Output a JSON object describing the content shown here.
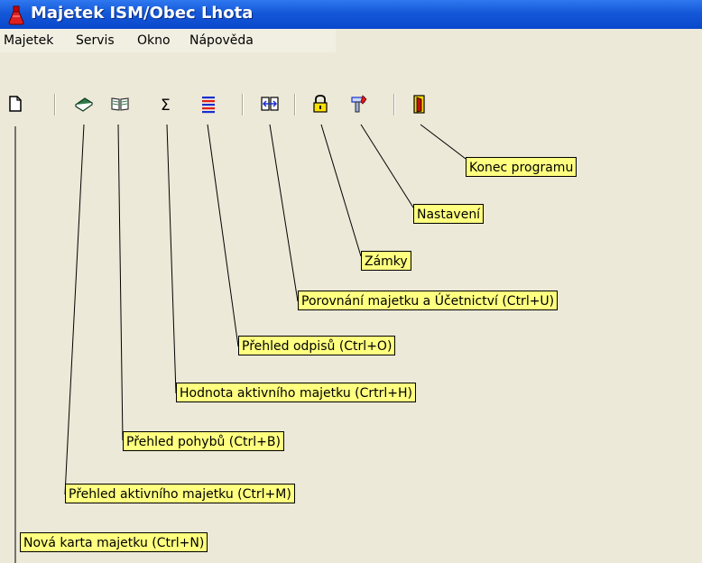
{
  "window": {
    "title": "Majetek ISM/Obec Lhota"
  },
  "menu": [
    "Majetek",
    "Servis",
    "Okno",
    "Nápověda"
  ],
  "toolbar": {
    "icons": [
      "new-document-icon",
      "book-closed-icon",
      "book-open-icon",
      "sigma-icon",
      "list-icon",
      "compare-icon",
      "lock-icon",
      "settings-icon",
      "exit-door-icon"
    ]
  },
  "callouts": {
    "konec": "Konec programu",
    "nastaveni": "Nastavení",
    "zamky": "Zámky",
    "porovnani": "Porovnání majetku a Účetnictví (Ctrl+U)",
    "odpisy": "Přehled odpisů (Ctrl+O)",
    "hodnota": "Hodnota aktivního majetku (Crtrl+H)",
    "pohyby": "Přehled pohybů (Ctrl+B)",
    "aktivni": "Přehled aktivního majetku (Ctrl+M)",
    "nova": "Nová karta majetku (Ctrl+N)"
  },
  "colors": {
    "titlebar": "#0a48cc",
    "callout_bg": "#ffff80",
    "client_bg": "#ece9d8"
  }
}
